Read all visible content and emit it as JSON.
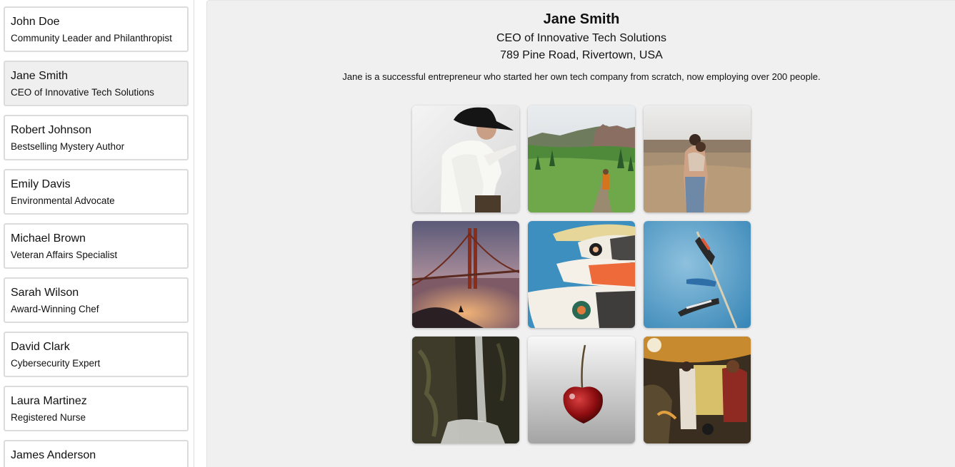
{
  "sidebar": {
    "people": [
      {
        "name": "John Doe",
        "title": "Community Leader and Philanthropist"
      },
      {
        "name": "Jane Smith",
        "title": "CEO of Innovative Tech Solutions"
      },
      {
        "name": "Robert Johnson",
        "title": "Bestselling Mystery Author"
      },
      {
        "name": "Emily Davis",
        "title": "Environmental Advocate"
      },
      {
        "name": "Michael Brown",
        "title": "Veteran Affairs Specialist"
      },
      {
        "name": "Sarah Wilson",
        "title": "Award-Winning Chef"
      },
      {
        "name": "David Clark",
        "title": "Cybersecurity Expert"
      },
      {
        "name": "Laura Martinez",
        "title": "Registered Nurse"
      },
      {
        "name": "James Anderson",
        "title": ""
      }
    ],
    "selected_index": 1
  },
  "profile": {
    "name": "Jane Smith",
    "title": "CEO of Innovative Tech Solutions",
    "address": "789 Pine Road, Rivertown, USA",
    "bio": "Jane is a successful entrepreneur who started her own tech company from scratch, now employing over 200 people."
  },
  "gallery": [
    "photo-person-black-hat",
    "photo-mountain-meadow-hiker",
    "photo-couple-in-field",
    "photo-golden-gate-bridge-fog",
    "photo-koi-fish-windsocks",
    "photo-koi-windsocks-sky",
    "photo-waterfall-canyon",
    "photo-red-cherry",
    "photo-street-market-rickshaw"
  ],
  "colors": {
    "main_background": "#f0f0f0",
    "selected_card": "#efefef",
    "card_border": "#dcdcdc"
  }
}
